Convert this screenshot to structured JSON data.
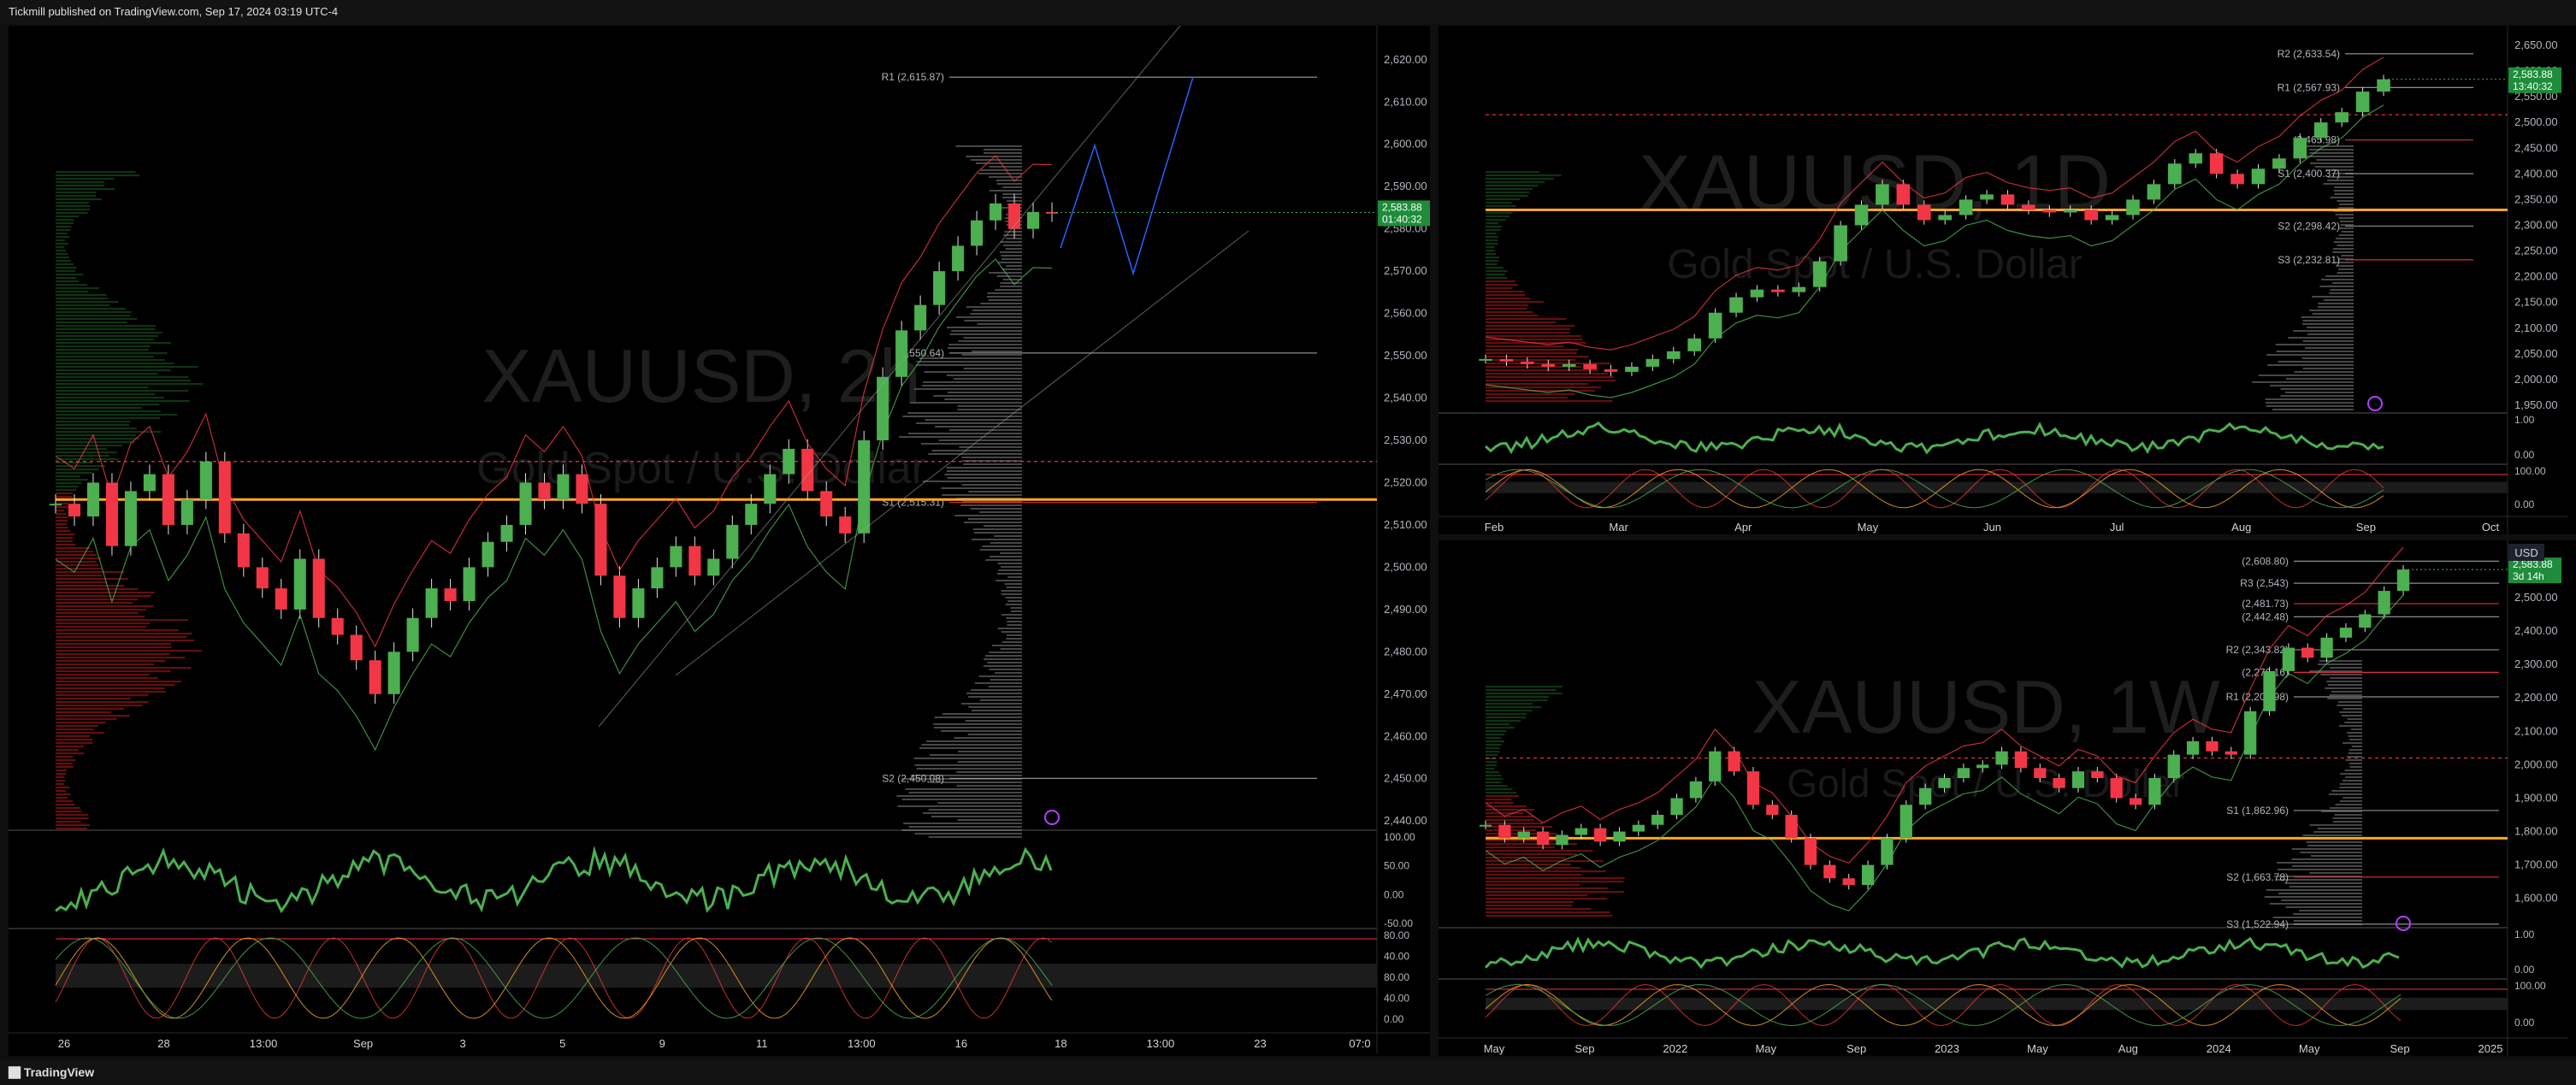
{
  "header": {
    "published_text": "Tickmill published on TradingView.com, Sep 17, 2024 03:19 UTC-4"
  },
  "footer": {
    "brand": "TradingView"
  },
  "colors": {
    "bull": "#26a69a",
    "bear": "#ef5350",
    "green": "#4caf50",
    "red": "#f23645",
    "orange": "#ffa726",
    "gray": "#787b86",
    "blue": "#2962ff",
    "pink": "#ff4081"
  },
  "chart_data": [
    {
      "type": "line",
      "symbol_watermark": "XAUUSD, 2h",
      "subtitle_watermark": "Gold Spot / U.S. Dollar",
      "x_tick_labels": [
        "26",
        "28",
        "13:00",
        "Sep",
        "3",
        "5",
        "9",
        "11",
        "13:00",
        "16",
        "18",
        "13:00",
        "23",
        "07:0"
      ],
      "y_tick_labels": [
        "2,620.00",
        "2,610.00",
        "2,600.00",
        "2,590.00",
        "2,580.00",
        "2,570.00",
        "2,560.00",
        "2,550.00",
        "2,540.00",
        "2,530.00",
        "2,520.00",
        "2,510.00",
        "2,500.00",
        "2,490.00",
        "2,480.00",
        "2,470.00",
        "2,460.00",
        "2,450.00",
        "2,440.00"
      ],
      "ylim": [
        2436,
        2624
      ],
      "last_price": "2,583.88",
      "countdown": "01:40:32",
      "level_labels": [
        {
          "label": "R1 (2,615.87)",
          "value": 2615.87
        },
        {
          "label": "(2,550.64)",
          "value": 2550.64
        },
        {
          "label": "S1 (2,515.31)",
          "value": 2515.31
        },
        {
          "label": "S2 (2,450.08)",
          "value": 2450.08
        }
      ],
      "price_series": [
        2515,
        2512,
        2520,
        2505,
        2518,
        2522,
        2510,
        2516,
        2525,
        2508,
        2500,
        2495,
        2490,
        2502,
        2488,
        2484,
        2478,
        2470,
        2480,
        2488,
        2495,
        2492,
        2500,
        2506,
        2510,
        2520,
        2516,
        2522,
        2515,
        2498,
        2488,
        2495,
        2500,
        2505,
        2498,
        2502,
        2510,
        2515,
        2522,
        2528,
        2518,
        2512,
        2508,
        2530,
        2545,
        2556,
        2562,
        2570,
        2576,
        2582,
        2586,
        2580,
        2584,
        2583.88
      ],
      "subpanel_1": {
        "y_tick_labels": [
          "100.00",
          "50.00",
          "0.00",
          "-50.00"
        ]
      },
      "subpanel_2": {
        "y_tick_labels": [
          "80.00",
          "40.00",
          "80.00",
          "40.00",
          "0.00"
        ]
      }
    },
    {
      "type": "line",
      "symbol_watermark": "XAUUSD, 1D",
      "subtitle_watermark": "Gold Spot / U.S. Dollar",
      "x_tick_labels": [
        "Feb",
        "Mar",
        "Apr",
        "May",
        "Jun",
        "Jul",
        "Aug",
        "Sep",
        "Oct"
      ],
      "y_tick_labels": [
        "2,650.00",
        "2,600.00",
        "2,550.00",
        "2,500.00",
        "2,450.00",
        "2,400.00",
        "2,350.00",
        "2,300.00",
        "2,250.00",
        "2,200.00",
        "2,150.00",
        "2,100.00",
        "2,050.00",
        "2,000.00",
        "1,950.00"
      ],
      "ylim": [
        1940,
        2655
      ],
      "last_price": "2,583.88",
      "countdown": "13:40:32",
      "level_labels": [
        {
          "label": "R2 (2,633.54)",
          "value": 2633.54
        },
        {
          "label": "R1 (2,567.93)",
          "value": 2567.93
        },
        {
          "label": "(2,465.98)",
          "value": 2465.98
        },
        {
          "label": "S1 (2,400.37)",
          "value": 2400.37
        },
        {
          "label": "S2 (2,298.42)",
          "value": 2298.42
        },
        {
          "label": "S3 (2,232.81)",
          "value": 2232.81
        }
      ],
      "price_series": [
        2040,
        2035,
        2030,
        2025,
        2030,
        2020,
        2015,
        2025,
        2040,
        2055,
        2080,
        2130,
        2160,
        2175,
        2170,
        2180,
        2230,
        2300,
        2340,
        2380,
        2340,
        2310,
        2320,
        2350,
        2360,
        2340,
        2330,
        2325,
        2330,
        2310,
        2320,
        2350,
        2380,
        2420,
        2440,
        2400,
        2380,
        2410,
        2430,
        2470,
        2500,
        2520,
        2560,
        2583.88
      ],
      "subpanel_1": {
        "y_tick_labels": [
          "1.00",
          "0.00"
        ]
      },
      "subpanel_2": {
        "y_tick_labels": [
          "100.00",
          "0.00"
        ]
      }
    },
    {
      "type": "line",
      "symbol_watermark": "XAUUSD, 1W",
      "subtitle_watermark": "Gold Spot / U.S. Dollar",
      "x_tick_labels": [
        "May",
        "Sep",
        "2022",
        "May",
        "Sep",
        "2023",
        "May",
        "Aug",
        "2024",
        "May",
        "Sep",
        "2025"
      ],
      "y_tick_labels": [
        "2,500.00",
        "2,400.00",
        "2,300.00",
        "2,200.00",
        "2,100.00",
        "2,000.00",
        "1,900.00",
        "1,800.00",
        "1,700.00",
        "1,600.00"
      ],
      "ylim": [
        1520,
        2620
      ],
      "currency": "USD",
      "last_price": "2,583.88",
      "countdown": "3d 14h",
      "level_labels": [
        {
          "label": "(2,608.80)",
          "value": 2608.8
        },
        {
          "label": "R3 (2,543)",
          "value": 2543
        },
        {
          "label": "(2,481.73)",
          "value": 2481.73
        },
        {
          "label": "(2,442.48)",
          "value": 2442.48
        },
        {
          "label": "R2 (2,343.82)",
          "value": 2343.82
        },
        {
          "label": "(2,276.16)",
          "value": 2276.16
        },
        {
          "label": "R1 (2,202.98)",
          "value": 2202.98
        },
        {
          "label": "S1 (1,862.96)",
          "value": 1862.96
        },
        {
          "label": "S2 (1,663.78)",
          "value": 1663.78
        },
        {
          "label": "S3 (1,522.94)",
          "value": 1522.94
        }
      ],
      "price_series": [
        1820,
        1780,
        1800,
        1760,
        1790,
        1810,
        1770,
        1800,
        1820,
        1850,
        1900,
        1950,
        2040,
        1980,
        1880,
        1850,
        1780,
        1700,
        1660,
        1640,
        1700,
        1780,
        1880,
        1930,
        1960,
        1990,
        2000,
        2040,
        1990,
        1960,
        1930,
        1980,
        1960,
        1900,
        1880,
        1960,
        2030,
        2070,
        2040,
        2030,
        2160,
        2280,
        2350,
        2320,
        2380,
        2410,
        2450,
        2520,
        2583.88
      ],
      "subpanel_1": {
        "y_tick_labels": [
          "1.00",
          "0.00"
        ]
      },
      "subpanel_2": {
        "y_tick_labels": [
          "100.00",
          "0.00"
        ]
      }
    }
  ]
}
